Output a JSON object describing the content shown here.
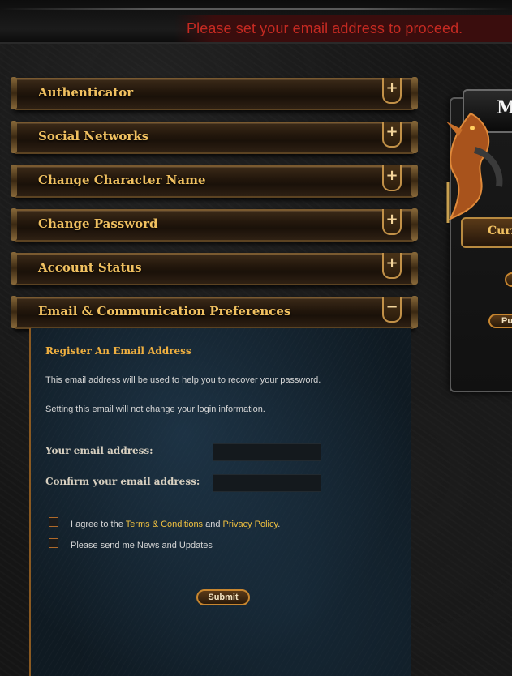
{
  "notice": "Please set your email address to proceed.",
  "accordion": [
    {
      "label": "Authenticator",
      "toggle": "+"
    },
    {
      "label": "Social Networks",
      "toggle": "+"
    },
    {
      "label": "Change Character Name",
      "toggle": "+"
    },
    {
      "label": "Change Password",
      "toggle": "+"
    },
    {
      "label": "Account Status",
      "toggle": "+"
    },
    {
      "label": "Email & Communication Preferences",
      "toggle": "−"
    }
  ],
  "email_panel": {
    "title": "Register An Email Address",
    "text1": "This email address will be used to help you to recover your password.",
    "text2": "Setting this email will not change your login information.",
    "email_label": "Your email address:",
    "email_value": "",
    "confirm_label": "Confirm your email address:",
    "confirm_value": "",
    "agree_prefix": "I agree to the ",
    "terms_link": "Terms & Conditions",
    "agree_and": " and ",
    "privacy_link": "Privacy Policy",
    "agree_suffix": ".",
    "news_label": "Please send me News and Updates",
    "submit_label": "Submit"
  },
  "sidebar": {
    "logo_text": "M",
    "tab_label": "Curr",
    "pill_label": "Pu"
  }
}
